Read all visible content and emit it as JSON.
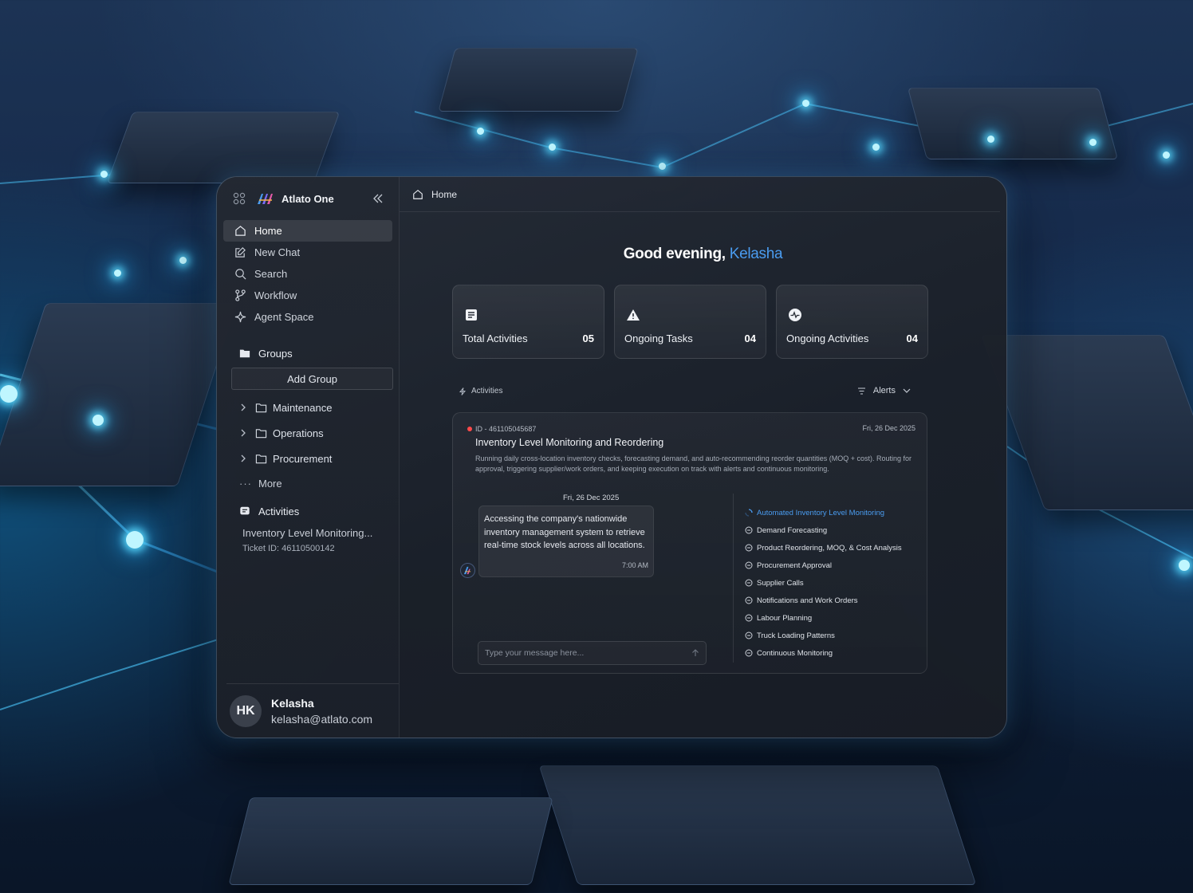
{
  "app": {
    "name": "Atlato One"
  },
  "sidebar": {
    "nav": [
      {
        "label": "Home",
        "icon": "home-icon",
        "active": true
      },
      {
        "label": "New Chat",
        "icon": "edit-icon",
        "active": false
      },
      {
        "label": "Search",
        "icon": "search-icon",
        "active": false
      },
      {
        "label": "Workflow",
        "icon": "workflow-icon",
        "active": false
      },
      {
        "label": "Agent Space",
        "icon": "sparkle-icon",
        "active": false
      }
    ],
    "groups_label": "Groups",
    "add_group_label": "Add Group",
    "groups": [
      "Maintenance",
      "Operations",
      "Procurement"
    ],
    "more_label": "More",
    "activities_label": "Activities",
    "activity": {
      "title": "Inventory Level Monitoring...",
      "ticket": "Ticket ID: 46110500142"
    }
  },
  "user": {
    "initials": "HK",
    "name": "Kelasha",
    "email": "kelasha@atlato.com"
  },
  "breadcrumb": {
    "label": "Home"
  },
  "greeting": {
    "prefix": "Good evening,",
    "name": "Kelasha"
  },
  "stats": [
    {
      "label": "Total Activities",
      "value": "05",
      "icon": "list-icon"
    },
    {
      "label": "Ongoing Tasks",
      "value": "04",
      "icon": "warning-icon"
    },
    {
      "label": "Ongoing Activities",
      "value": "04",
      "icon": "pulse-icon"
    }
  ],
  "activities_section": {
    "label": "Activities",
    "filter_label": "Alerts"
  },
  "activity_card": {
    "id": "ID - 461105045687",
    "date": "Fri, 26 Dec 2025",
    "title": "Inventory Level Monitoring and Reordering",
    "description": "Running daily cross-location inventory checks, forecasting demand, and auto-recommending reorder quantities (MOQ + cost). Routing for approval, triggering supplier/work orders, and keeping execution on track with alerts and continuous monitoring.",
    "chat": {
      "date": "Fri, 26 Dec 2025",
      "message": "Accessing the company's nationwide inventory management system to retrieve real-time stock levels across all locations.",
      "time": "7:00 AM"
    },
    "input_placeholder": "Type your message here...",
    "steps": [
      "Automated Inventory Level Monitoring",
      "Demand Forecasting",
      "Product Reordering, MOQ, & Cost Analysis",
      "Procurement Approval",
      "Supplier Calls",
      "Notifications and Work Orders",
      "Labour Planning",
      "Truck Loading Patterns",
      "Continuous Monitoring"
    ]
  },
  "colors": {
    "accent": "#4a9cf0",
    "alert": "#ff4a4a"
  }
}
